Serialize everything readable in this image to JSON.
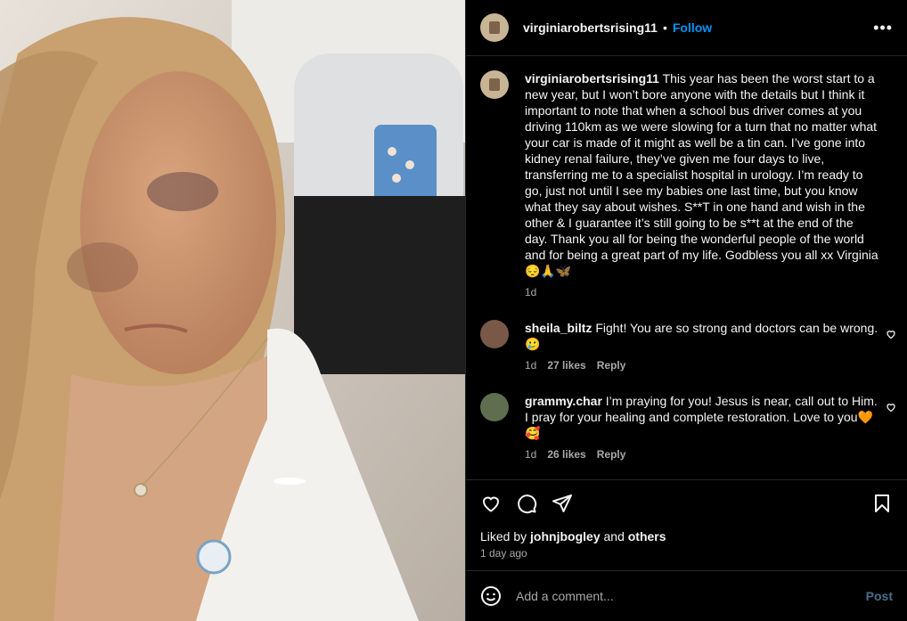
{
  "post": {
    "username": "virginiarobertsrising11",
    "separator": "•",
    "follow_label": "Follow",
    "more_label": "•••"
  },
  "caption": {
    "username": "virginiarobertsrising11",
    "text": "This year has been the worst start to a new year, but I won’t bore anyone with the details but I think it important to note that when a school bus driver comes at you driving 110km as we were slowing for a turn that no matter what your car is made of it might as well be a tin can. I’ve gone into kidney renal failure, they’ve given me four days to live, transferring me to a specialist hospital in urology. I’m ready to go, just not until I see my babies one last time, but you know what they say about wishes. S**T in one hand and wish in the other & I guarantee it’s still going to be s**t at the end of the day. Thank you all for being the wonderful people of the world and for being a great part of my life. Godbless you all xx Virginia 😔🙏🦋",
    "time": "1d"
  },
  "comments": [
    {
      "username": "sheila_biltz",
      "text": "Fight! You are so strong and doctors can be wrong. 🥲",
      "time": "1d",
      "likes": "27 likes",
      "reply": "Reply"
    },
    {
      "username": "grammy.char",
      "text": "I’m praying for you! Jesus is near, call out to Him. I pray for your healing and complete restoration. Love to you🧡🥰",
      "time": "1d",
      "likes": "26 likes",
      "reply": "Reply"
    }
  ],
  "liked_by": {
    "prefix": "Liked by",
    "user": "johnjbogley",
    "joiner": "and",
    "others": "others"
  },
  "posted_ago": "1 day ago",
  "add_comment": {
    "placeholder": "Add a comment...",
    "post_label": "Post"
  },
  "icons": {
    "like": "heart-icon",
    "comment": "comment-icon",
    "share": "share-icon",
    "save": "bookmark-icon",
    "emoji": "emoji-icon",
    "more": "more-icon"
  },
  "colors": {
    "accent": "#0095f6",
    "background": "#000000",
    "muted": "#a8a8a8"
  }
}
